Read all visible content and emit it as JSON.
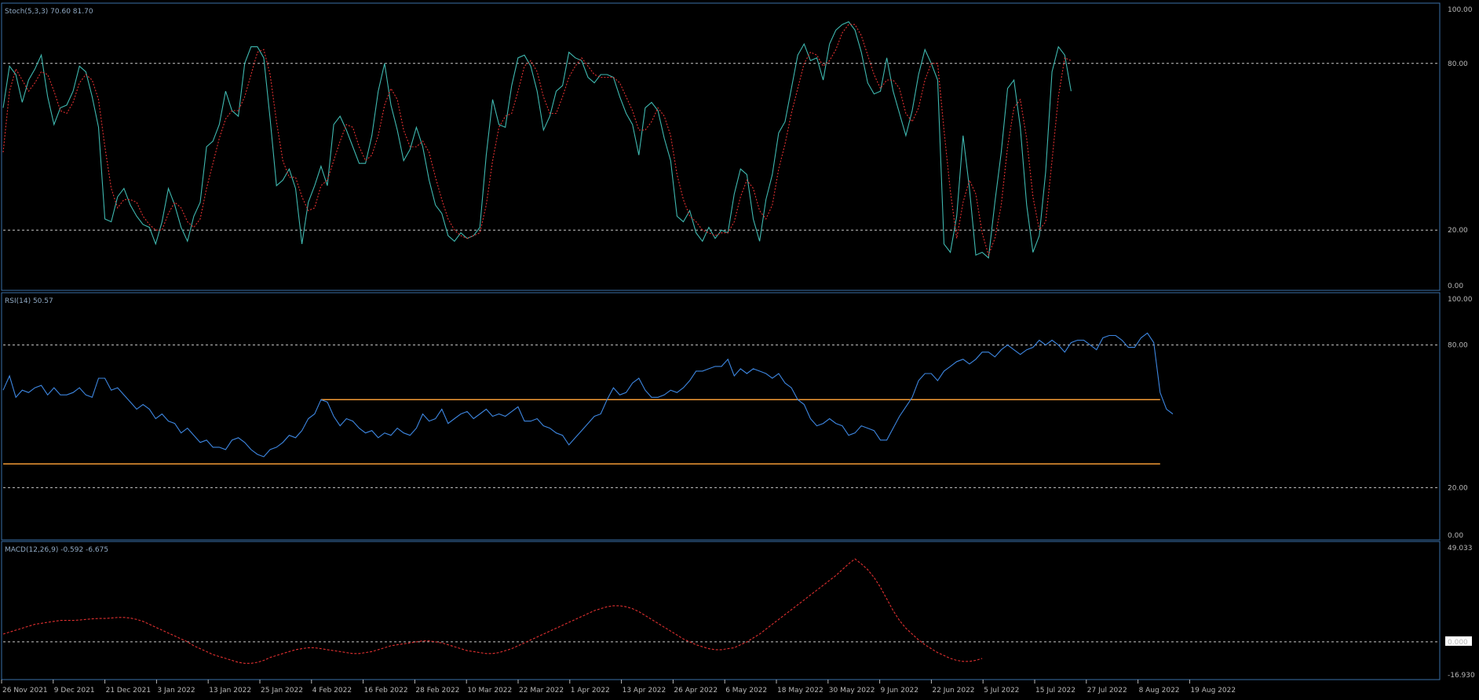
{
  "colors": {
    "background": "#000000",
    "frame": "#3a6fa8",
    "grid": "#c8c8c8",
    "stoch_main": "#3fb8b0",
    "stoch_signal": "#e03030",
    "rsi": "#3d86e0",
    "support_resistance": "#f29a35",
    "macd_signal": "#e03030",
    "text": "#b8b8b8"
  },
  "panels": {
    "stoch": {
      "label": "Stoch(5,3,3) 70.60 81.70"
    },
    "rsi": {
      "label": "RSI(14) 50.57"
    },
    "macd": {
      "label": "MACD(12,26,9) -0.592 -6.675"
    }
  },
  "chart_data": [
    {
      "type": "line",
      "panel": "stoch",
      "ylim": [
        0,
        100
      ],
      "y_ticks": [
        "100.00",
        "80.00",
        "20.00",
        "0.00"
      ],
      "levels": [
        80,
        20
      ],
      "series": [
        {
          "values": [
            64,
            79,
            76,
            66,
            74,
            78,
            83,
            68,
            58,
            64,
            65,
            70,
            79,
            77,
            68,
            57,
            24,
            23,
            32,
            35,
            29,
            25,
            22,
            21,
            15,
            23,
            35,
            29,
            21,
            16,
            25,
            30,
            50,
            52,
            58,
            70,
            63,
            61,
            80,
            86,
            86,
            82,
            60,
            36,
            38,
            42,
            35,
            15,
            30,
            36,
            43,
            36,
            58,
            61,
            56,
            50,
            44,
            44,
            54,
            70,
            80,
            65,
            56,
            45,
            49,
            57,
            50,
            38,
            29,
            26,
            18,
            16,
            19,
            17,
            18,
            21,
            47,
            67,
            58,
            57,
            72,
            82,
            83,
            79,
            70,
            56,
            61,
            70,
            72,
            84,
            82,
            81,
            75,
            73,
            76,
            76,
            75,
            68,
            62,
            58,
            47,
            64,
            66,
            63,
            53,
            45,
            25,
            23,
            27,
            19,
            16,
            21,
            17,
            20,
            19,
            33,
            42,
            40,
            24,
            16,
            31,
            40,
            55,
            59,
            71,
            83,
            87,
            81,
            82,
            74,
            87,
            92,
            94,
            95,
            92,
            84,
            73,
            69,
            70,
            82,
            70,
            62,
            54,
            63,
            76,
            85,
            80,
            74,
            15,
            12,
            25,
            54,
            35,
            11,
            12,
            10,
            30,
            48,
            71,
            74,
            57,
            29,
            12,
            18,
            41,
            77,
            86,
            83,
            70
          ]
        },
        {
          "values": [
            48,
            70,
            78,
            74,
            70,
            73,
            77,
            76,
            70,
            63,
            62,
            66,
            73,
            76,
            74,
            67,
            50,
            35,
            28,
            31,
            31,
            30,
            25,
            22,
            20,
            20,
            26,
            30,
            28,
            23,
            21,
            24,
            35,
            44,
            53,
            60,
            63,
            63,
            68,
            76,
            84,
            85,
            76,
            59,
            45,
            39,
            39,
            32,
            27,
            28,
            36,
            38,
            45,
            52,
            58,
            57,
            50,
            45,
            47,
            54,
            65,
            71,
            67,
            56,
            50,
            50,
            52,
            48,
            39,
            31,
            24,
            20,
            18,
            17,
            18,
            19,
            29,
            45,
            57,
            61,
            62,
            70,
            79,
            81,
            77,
            68,
            62,
            62,
            68,
            75,
            79,
            82,
            79,
            76,
            75,
            75,
            75,
            73,
            68,
            63,
            56,
            56,
            59,
            64,
            61,
            54,
            40,
            31,
            25,
            23,
            20,
            19,
            18,
            19,
            19,
            23,
            32,
            38,
            35,
            27,
            24,
            29,
            42,
            51,
            62,
            71,
            80,
            84,
            83,
            79,
            81,
            85,
            91,
            94,
            94,
            90,
            83,
            76,
            71,
            74,
            74,
            71,
            62,
            59,
            64,
            74,
            80,
            80,
            56,
            34,
            17,
            30,
            38,
            33,
            19,
            11,
            17,
            29,
            50,
            64,
            67,
            53,
            32,
            20,
            23,
            45,
            68,
            82,
            81
          ]
        }
      ]
    },
    {
      "type": "line",
      "panel": "rsi",
      "ylim": [
        0,
        100
      ],
      "y_ticks": [
        "100.00",
        "80.00",
        "20.00",
        "0.00"
      ],
      "levels": [
        80,
        20
      ],
      "horizontal_lines": [
        {
          "y": 57,
          "from_index": 50,
          "to_index": 182
        },
        {
          "y": 30,
          "from_index": 0,
          "to_index": 182
        }
      ],
      "series": [
        {
          "values": [
            61,
            67,
            58,
            61,
            60,
            62,
            63,
            59,
            62,
            59,
            59,
            60,
            62,
            59,
            58,
            66,
            66,
            61,
            62,
            59,
            56,
            53,
            55,
            53,
            49,
            51,
            48,
            47,
            43,
            45,
            42,
            39,
            40,
            37,
            37,
            36,
            40,
            41,
            39,
            36,
            34,
            33,
            36,
            37,
            39,
            42,
            41,
            44,
            49,
            51,
            57,
            56,
            50,
            46,
            49,
            48,
            45,
            43,
            44,
            41,
            43,
            42,
            45,
            43,
            42,
            45,
            51,
            48,
            49,
            53,
            47,
            49,
            51,
            52,
            49,
            51,
            53,
            50,
            51,
            50,
            52,
            54,
            48,
            48,
            49,
            46,
            45,
            43,
            42,
            38,
            41,
            44,
            47,
            50,
            51,
            57,
            62,
            59,
            60,
            64,
            66,
            61,
            58,
            58,
            59,
            61,
            60,
            62,
            65,
            69,
            69,
            70,
            71,
            71,
            74,
            67,
            70,
            68,
            70,
            69,
            68,
            66,
            68,
            64,
            62,
            57,
            55,
            49,
            46,
            47,
            49,
            47,
            46,
            42,
            43,
            46,
            45,
            44,
            40,
            40,
            45,
            50,
            54,
            58,
            65,
            68,
            68,
            65,
            69,
            71,
            73,
            74,
            72,
            74,
            77,
            77,
            75,
            78,
            80,
            78,
            76,
            78,
            79,
            82,
            80,
            82,
            80,
            77,
            81,
            82,
            82,
            80,
            78,
            83,
            84,
            84,
            82,
            79,
            79,
            83,
            85,
            81,
            60,
            53,
            51
          ]
        }
      ]
    },
    {
      "type": "line",
      "panel": "macd",
      "y_ticks": [
        "49.033",
        "0.000",
        "-16.930"
      ],
      "ylim": [
        -16.93,
        49.033
      ],
      "current_value_label": "0.000",
      "levels": [
        0
      ],
      "series": [
        {
          "values": [
            4,
            5,
            6,
            7,
            8,
            9,
            9.5,
            10,
            10.5,
            11,
            11,
            11,
            11.2,
            11.5,
            11.8,
            12,
            12,
            12.2,
            12.5,
            12.5,
            12.2,
            11.5,
            10.5,
            9,
            7.5,
            6,
            4.5,
            3,
            1.5,
            0,
            -2,
            -3.5,
            -5,
            -6.5,
            -7.5,
            -8.5,
            -9.5,
            -10.5,
            -11,
            -11,
            -10.5,
            -9.5,
            -8,
            -7,
            -6,
            -5,
            -4,
            -3.5,
            -3,
            -3,
            -3.5,
            -4,
            -4.5,
            -5,
            -5.5,
            -6,
            -6,
            -5.5,
            -5,
            -4,
            -3,
            -2,
            -1.5,
            -1,
            -0.5,
            0,
            0.5,
            0.5,
            0,
            -0.5,
            -1.5,
            -2.5,
            -3.5,
            -4.5,
            -5,
            -5.5,
            -6,
            -6,
            -5.5,
            -4.5,
            -3.5,
            -2,
            -0.5,
            1,
            2.5,
            4,
            5.5,
            7,
            8.5,
            10,
            11.5,
            13,
            14.5,
            16,
            17,
            18,
            18.5,
            18.5,
            18,
            17,
            15.5,
            13.5,
            11.5,
            9.5,
            7.5,
            5.5,
            3.5,
            1.5,
            0,
            -1.5,
            -2.5,
            -3.5,
            -4,
            -4,
            -3.5,
            -3,
            -1.5,
            0,
            2,
            4,
            6.5,
            9,
            11.5,
            14,
            16.5,
            19,
            21.5,
            24,
            26.5,
            29,
            31.5,
            34,
            37,
            40,
            42.5,
            40,
            37,
            33,
            28,
            22,
            16,
            11,
            7,
            4,
            1,
            -1.5,
            -3.5,
            -5.5,
            -7,
            -8.5,
            -9.5,
            -10,
            -10,
            -9.5,
            -8.5
          ]
        }
      ]
    },
    {
      "type": "axis",
      "panel": "time",
      "x_ticks": [
        "26 Nov 2021",
        "9 Dec 2021",
        "21 Dec 2021",
        "3 Jan 2022",
        "13 Jan 2022",
        "25 Jan 2022",
        "4 Feb 2022",
        "16 Feb 2022",
        "28 Feb 2022",
        "10 Mar 2022",
        "22 Mar 2022",
        "1 Apr 2022",
        "13 Apr 2022",
        "26 Apr 2022",
        "6 May 2022",
        "18 May 2022",
        "30 May 2022",
        "9 Jun 2022",
        "22 Jun 2022",
        "5 Jul 2022",
        "15 Jul 2022",
        "27 Jul 2022",
        "8 Aug 2022",
        "19 Aug 2022"
      ]
    }
  ]
}
